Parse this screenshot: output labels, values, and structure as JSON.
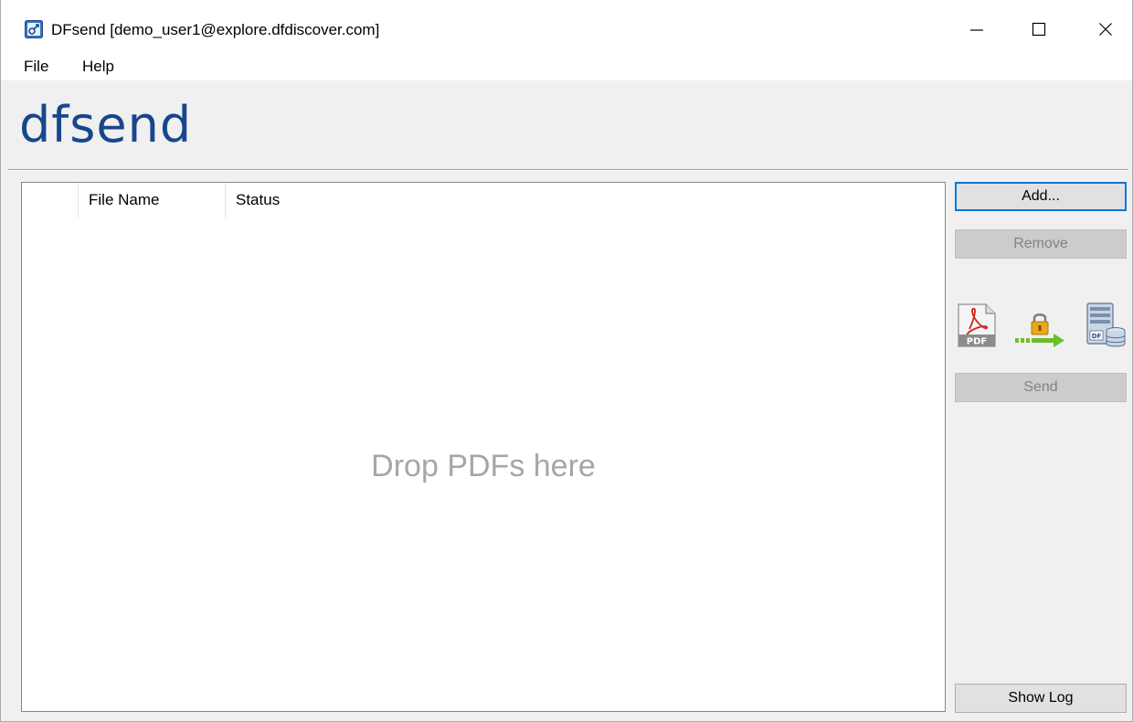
{
  "window": {
    "title": "DFsend [demo_user1@explore.dfdiscover.com]",
    "icon": "dfsend-app-icon",
    "controls": {
      "minimize_icon": "minimize-icon",
      "maximize_icon": "maximize-icon",
      "close_icon": "close-icon"
    }
  },
  "menu": {
    "items": [
      {
        "label": "File"
      },
      {
        "label": "Help"
      }
    ]
  },
  "logo": {
    "text": "dfsend",
    "color": "#17468c"
  },
  "filelist": {
    "columns": [
      "",
      "File Name",
      "Status"
    ],
    "rows": [],
    "drop_hint": "Drop PDFs here"
  },
  "actions": {
    "add_label": "Add...",
    "remove_label": "Remove",
    "send_label": "Send",
    "show_log_label": "Show Log",
    "remove_enabled": false,
    "send_enabled": false
  },
  "workflow_icons": [
    "pdf-file-icon",
    "secure-transfer-arrow-icon",
    "dfdiscover-server-icon"
  ],
  "colors": {
    "accent_focus": "#0078d7",
    "arrow_green": "#6cbe2a",
    "lock_gold": "#e3a21a"
  }
}
